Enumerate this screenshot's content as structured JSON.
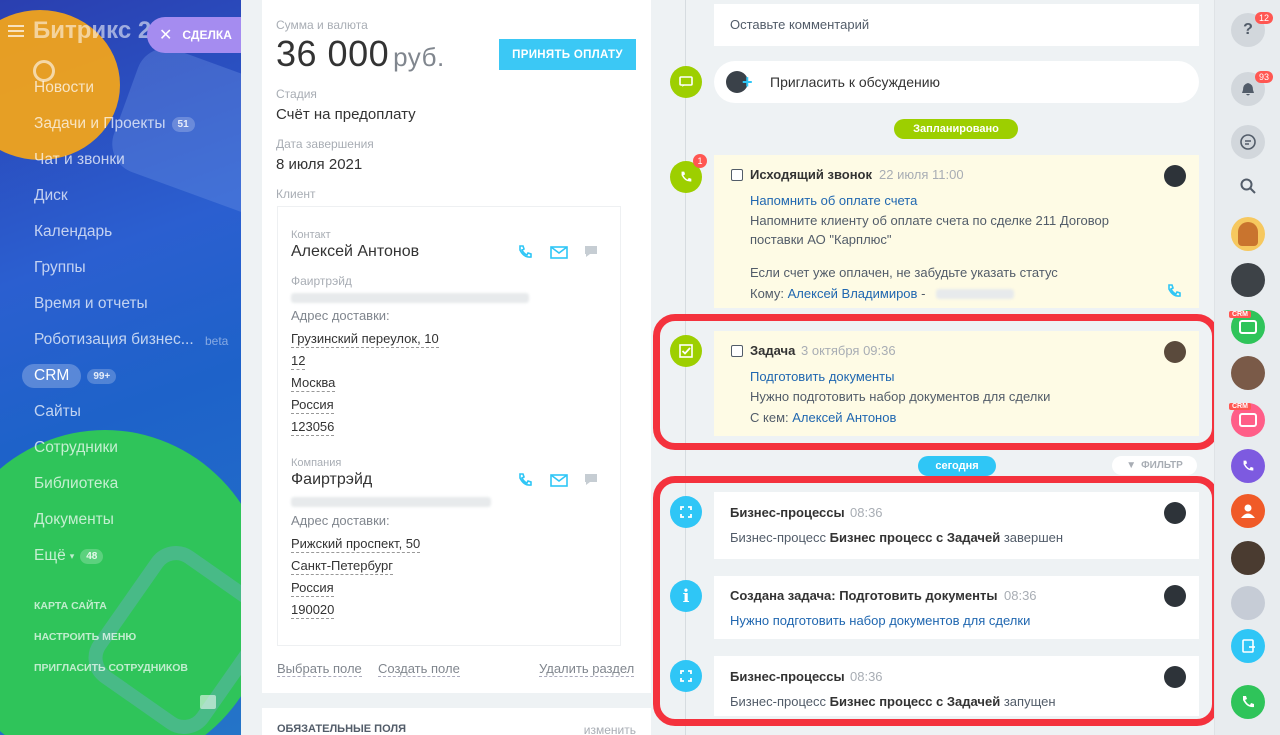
{
  "sidebar": {
    "logo": "Битрикс 2",
    "deal_tab": "СДЕЛКА",
    "items": [
      {
        "label": "Новости"
      },
      {
        "label": "Задачи и Проекты",
        "count": "51"
      },
      {
        "label": "Чат и звонки"
      },
      {
        "label": "Диск"
      },
      {
        "label": "Календарь"
      },
      {
        "label": "Группы"
      },
      {
        "label": "Время и отчеты"
      },
      {
        "label": "Роботизация бизнес...",
        "note": "beta"
      },
      {
        "label": "CRM",
        "count": "99+"
      },
      {
        "label": "Сайты"
      },
      {
        "label": "Сотрудники"
      },
      {
        "label": "Библиотека"
      },
      {
        "label": "Документы"
      },
      {
        "label": "Ещё",
        "count": "48"
      }
    ],
    "small_links": [
      "КАРТА САЙТА",
      "НАСТРОИТЬ МЕНЮ",
      "ПРИГЛАСИТЬ СОТРУДНИКОВ"
    ]
  },
  "deal": {
    "sum_label": "Сумма и валюта",
    "sum_value": "36 000",
    "currency": "руб.",
    "accept_button": "ПРИНЯТЬ ОПЛАТУ",
    "stage_label": "Стадия",
    "stage_value": "Счёт на предоплату",
    "close_date_label": "Дата завершения",
    "close_date_value": "8 июля 2021",
    "client_label": "Клиент",
    "contact": {
      "label": "Контакт",
      "name": "Алексей Антонов",
      "company_label": "Фаиртрэйд",
      "address_label": "Адрес доставки:",
      "address_lines": [
        "Грузинский переулок, 10",
        "12",
        "Москва",
        "Россия",
        "123056"
      ]
    },
    "company": {
      "label": "Компания",
      "name": "Фаиртрэйд",
      "address_label": "Адрес доставки:",
      "address_lines": [
        "Рижский проспект, 50",
        "Санкт-Петербург",
        "Россия",
        "190020"
      ]
    },
    "footer_links": {
      "select_field": "Выбрать поле",
      "create_field": "Создать поле",
      "delete_section": "Удалить раздел"
    },
    "required_fields": {
      "title": "ОБЯЗАТЕЛЬНЫЕ ПОЛЯ",
      "edit": "изменить"
    }
  },
  "timeline": {
    "comment_placeholder": "Оставьте комментарий",
    "invite_label": "Пригласить к обсуждению",
    "planned_label": "Запланировано",
    "today_label": "сегодня",
    "filter_label": "ФИЛЬТР",
    "call": {
      "badge": "1",
      "title": "Исходящий звонок",
      "time": "22 июля 11:00",
      "subject": "Напомнить об оплате счета",
      "text1": "Напомните клиенту об оплате счета по сделке 211 Договор поставки АО \"Карплюс\"",
      "text2": "Если счет уже оплачен, не забудьте указать статус",
      "to_label": "Кому:",
      "to_name": "Алексей Владимиров"
    },
    "task": {
      "title": "Задача",
      "time": "3 октября 09:36",
      "subject": "Подготовить документы",
      "text": "Нужно подготовить набор документов для сделки",
      "with_label": "С кем:",
      "with_name": "Алексей Антонов"
    },
    "events": [
      {
        "title": "Бизнес-процессы",
        "time": "08:36",
        "prefix": "Бизнес-процесс",
        "bold": "Бизнес процесс с Задачей",
        "suffix": "завершен"
      },
      {
        "title": "Создана задача: Подготовить документы",
        "time": "08:36",
        "link": "Нужно подготовить набор документов для сделки"
      },
      {
        "title": "Бизнес-процессы",
        "time": "08:36",
        "prefix": "Бизнес-процесс",
        "bold": "Бизнес процесс с Задачей",
        "suffix": "запущен"
      }
    ]
  },
  "rightbar": {
    "help_badge": "12",
    "notif_badge": "93",
    "crm_tag": "CRM"
  },
  "colors": {
    "accent": "#3bc8f5",
    "green": "#9dcf00",
    "highlight": "#f4323d",
    "link": "#2067b0"
  }
}
